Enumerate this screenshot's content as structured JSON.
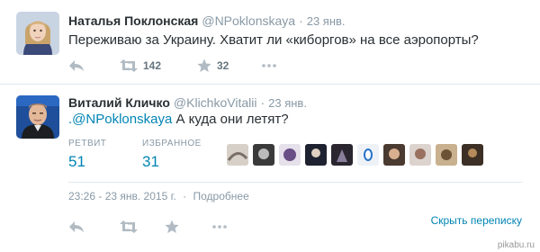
{
  "tweet1": {
    "fullname": "Наталья Поклонская",
    "username": "@NPoklonskaya",
    "dot": "·",
    "time": "23 янв.",
    "text": "Переживаю за Украину. Хватит ли «киборгов» на все аэропорты?",
    "retweets": "142",
    "favorites": "32"
  },
  "tweet2": {
    "fullname": "Виталий Кличко",
    "username": "@KlichkoVitalii",
    "dot": "·",
    "time": "23 янв.",
    "reply_prefix": ".",
    "mention": "@NPoklonskaya",
    "text": " А куда они летят?",
    "retweet_label": "РЕТВИТ",
    "retweet_count": "51",
    "favorites_label": "ИЗБРАННОЕ",
    "favorites_count": "31",
    "meta_time": "23:26 - 23 янв. 2015 г.",
    "meta_dot": "·",
    "details_link": "Подробнее",
    "expand_link": "Скрыть переписку"
  },
  "watermark": "pikabu.ru",
  "icons": {
    "reply": "reply-icon",
    "retweet": "retweet-icon",
    "favorite": "star-icon",
    "more": "more-icon"
  },
  "colors": {
    "link": "#0084b4",
    "muted": "#8899a6",
    "icon": "#b1bbc3"
  }
}
